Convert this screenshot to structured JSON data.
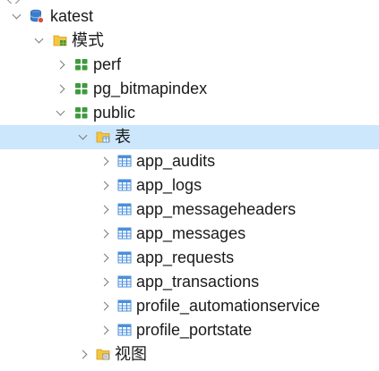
{
  "tree": {
    "connection": {
      "label": "katest",
      "icon": "database-icon"
    },
    "schemas_folder": {
      "label": "模式",
      "icon": "schema-folder-icon"
    },
    "schemas": [
      {
        "label": "perf",
        "icon": "schema-icon",
        "expanded": false
      },
      {
        "label": "pg_bitmapindex",
        "icon": "schema-icon",
        "expanded": false
      },
      {
        "label": "public",
        "icon": "schema-icon",
        "expanded": true
      }
    ],
    "tables_folder": {
      "label": "表",
      "icon": "table-folder-icon",
      "selected": true
    },
    "tables": [
      "app_audits",
      "app_logs",
      "app_messageheaders",
      "app_messages",
      "app_requests",
      "app_transactions",
      "profile_automationservice",
      "profile_portstate"
    ],
    "views_folder": {
      "label": "视图",
      "icon": "view-folder-icon"
    }
  },
  "colors": {
    "selection": "#cce6fb",
    "schema_icon": "#3f9a3f",
    "table_icon": "#4a8fdc",
    "folder_icon": "#f4c542",
    "database_icon": "#3d7cc9"
  }
}
